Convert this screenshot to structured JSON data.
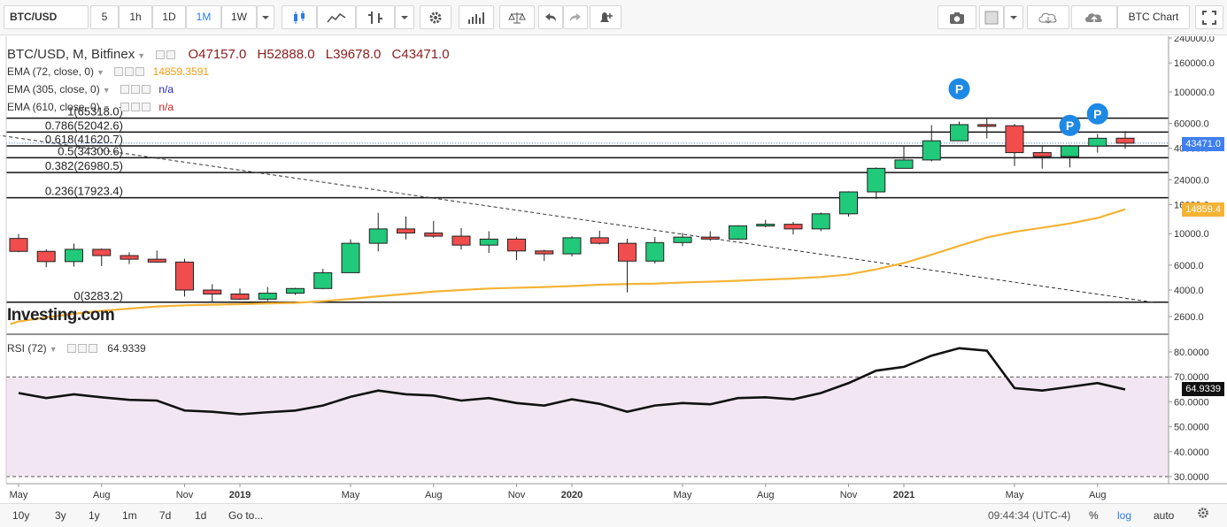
{
  "toolbar": {
    "symbol": "BTC/USD",
    "intervals": [
      "5",
      "1h",
      "1D",
      "1M",
      "1W"
    ],
    "active_interval": "1M",
    "chart_label": "BTC Chart"
  },
  "legend": {
    "title": "BTC/USD, M, Bitfinex",
    "open": "O47157.0",
    "high": "H52888.0",
    "low": "L39678.0",
    "close": "C43471.0",
    "ema72_label": "EMA (72, close, 0)",
    "ema72_value": "14859.3591",
    "ema305_label": "EMA (305, close, 0)",
    "ema305_value": "n/a",
    "ema610_label": "EMA (610, close, 0)",
    "ema610_value": "n/a",
    "rsi_label": "RSI (72)",
    "rsi_value": "64.9339"
  },
  "colors": {
    "up": "#21c97a",
    "down": "#f24d4d",
    "ema": "#f5b335",
    "rsi_band": "#f3e6f3",
    "blue_badge": "#1e88e5",
    "last_price_bg": "#3f7ff0",
    "accent": "#2b7de9"
  },
  "fib_levels": [
    "1(65318.0)",
    "0.786(52042.6)",
    "0.618(41620.7)",
    "0.5(34300.6)",
    "0.382(26980.5)",
    "0.236(17923.4)",
    "0(3283.2)"
  ],
  "price_axis": [
    "240000.0",
    "160000.0",
    "100000.0",
    "60000.0",
    "40000.0",
    "24000.0",
    "16000.0",
    "10000.0",
    "6000.0",
    "4000.0",
    "2600.0"
  ],
  "rsi_axis": [
    "80.0000",
    "70.0000",
    "60.0000",
    "50.0000",
    "40.0000",
    "30.0000"
  ],
  "time_axis": [
    "May",
    "Aug",
    "Nov",
    "2019",
    "May",
    "Aug",
    "Nov",
    "2020",
    "May",
    "Aug",
    "Nov",
    "2021",
    "May",
    "Aug"
  ],
  "last_price_tag": "43471.0",
  "ema_price_tag": "14859.4",
  "rsi_tag": "64.9339",
  "watermark": "Investing.com",
  "badges": [
    "P",
    "P",
    "P"
  ],
  "bottom": {
    "ranges": [
      "10y",
      "3y",
      "1y",
      "1m",
      "7d",
      "1d",
      "Go to..."
    ],
    "clock": "09:44:34 (UTC-4)",
    "pct": "%",
    "log": "log",
    "auto": "auto"
  },
  "chart_data": {
    "type": "candlestick",
    "months": [
      "2018-05",
      "2018-06",
      "2018-07",
      "2018-08",
      "2018-09",
      "2018-10",
      "2018-11",
      "2018-12",
      "2019-01",
      "2019-02",
      "2019-03",
      "2019-04",
      "2019-05",
      "2019-06",
      "2019-07",
      "2019-08",
      "2019-09",
      "2019-10",
      "2019-11",
      "2019-12",
      "2020-01",
      "2020-02",
      "2020-03",
      "2020-04",
      "2020-05",
      "2020-06",
      "2020-07",
      "2020-08",
      "2020-09",
      "2020-10",
      "2020-11",
      "2020-12",
      "2021-01",
      "2021-02",
      "2021-03",
      "2021-04",
      "2021-05",
      "2021-06",
      "2021-07",
      "2021-08",
      "2021-09"
    ],
    "candles": [
      [
        9250,
        9950,
        7400,
        7500
      ],
      [
        7500,
        7750,
        5800,
        6350
      ],
      [
        6350,
        8500,
        5850,
        7750
      ],
      [
        7750,
        7850,
        5900,
        7000
      ],
      [
        7000,
        7400,
        6100,
        6600
      ],
      [
        6600,
        7600,
        6250,
        6300
      ],
      [
        6300,
        6650,
        3600,
        4000
      ],
      [
        4000,
        4400,
        3283,
        3750
      ],
      [
        3750,
        4100,
        3400,
        3450
      ],
      [
        3450,
        4200,
        3350,
        3800
      ],
      [
        3800,
        4150,
        3700,
        4100
      ],
      [
        4100,
        5650,
        4050,
        5300
      ],
      [
        5300,
        9100,
        5300,
        8550
      ],
      [
        8550,
        14000,
        7500,
        10800
      ],
      [
        10800,
        13200,
        9100,
        10100
      ],
      [
        10100,
        12300,
        9350,
        9600
      ],
      [
        9600,
        10950,
        7700,
        8300
      ],
      [
        8300,
        10400,
        7300,
        9150
      ],
      [
        9150,
        9500,
        6500,
        7550
      ],
      [
        7550,
        7700,
        6400,
        7200
      ],
      [
        7200,
        9600,
        6900,
        9350
      ],
      [
        9350,
        10500,
        8400,
        8550
      ],
      [
        8550,
        9200,
        3850,
        6400
      ],
      [
        6400,
        9450,
        6150,
        8650
      ],
      [
        8650,
        10100,
        8150,
        9450
      ],
      [
        9450,
        10400,
        8900,
        9150
      ],
      [
        9150,
        11450,
        9050,
        11350
      ],
      [
        11350,
        12500,
        11100,
        11650
      ],
      [
        11650,
        12100,
        9850,
        10800
      ],
      [
        10800,
        14100,
        10400,
        13800
      ],
      [
        13800,
        19900,
        13200,
        19700
      ],
      [
        19700,
        29300,
        17600,
        28900
      ],
      [
        28900,
        41900,
        28800,
        33100
      ],
      [
        33100,
        58300,
        32300,
        45200
      ],
      [
        45200,
        61800,
        45000,
        58800
      ],
      [
        58800,
        64800,
        47000,
        57700
      ],
      [
        57700,
        59500,
        30000,
        37300
      ],
      [
        37300,
        41300,
        28800,
        35000
      ],
      [
        35000,
        42300,
        29300,
        41500
      ],
      [
        41500,
        50500,
        37300,
        47100
      ],
      [
        47157,
        52888,
        39678,
        43471
      ]
    ],
    "ema72": [
      2400,
      2560,
      2720,
      2850,
      2960,
      3060,
      3120,
      3150,
      3180,
      3220,
      3250,
      3340,
      3460,
      3610,
      3750,
      3900,
      4000,
      4100,
      4150,
      4200,
      4270,
      4360,
      4410,
      4440,
      4520,
      4580,
      4650,
      4740,
      4820,
      4940,
      5150,
      5600,
      6200,
      7100,
      8200,
      9400,
      10300,
      11000,
      11800,
      12900,
      14859
    ],
    "rsi": [
      63.5,
      61.5,
      63.0,
      61.8,
      60.8,
      60.5,
      56.5,
      56.0,
      55.0,
      55.8,
      56.5,
      58.5,
      62.0,
      64.5,
      63.0,
      62.5,
      60.5,
      61.5,
      59.5,
      58.5,
      61.0,
      59.2,
      56.0,
      58.5,
      59.5,
      59.0,
      61.5,
      61.8,
      61.0,
      63.5,
      67.5,
      72.5,
      74.0,
      78.5,
      81.5,
      80.5,
      65.5,
      64.5,
      66.0,
      67.5,
      64.9339
    ],
    "fib": [
      {
        "ratio": 1,
        "price": 65318.0
      },
      {
        "ratio": 0.786,
        "price": 52042.6
      },
      {
        "ratio": 0.618,
        "price": 41620.7
      },
      {
        "ratio": 0.5,
        "price": 34300.6
      },
      {
        "ratio": 0.382,
        "price": 26980.5
      },
      {
        "ratio": 0.236,
        "price": 17923.4
      },
      {
        "ratio": 0,
        "price": 3283.2
      }
    ],
    "price_scale": "log",
    "trendline": {
      "from": {
        "month": "2017-12",
        "price": 65318
      },
      "to": {
        "month": "2021-10",
        "price": 3283.2
      }
    },
    "badge_months": [
      "2021-03",
      "2021-07",
      "2021-08"
    ],
    "badge_prices": [
      105000,
      58000,
      70000
    ],
    "rsi_lines": [
      70,
      30
    ]
  }
}
